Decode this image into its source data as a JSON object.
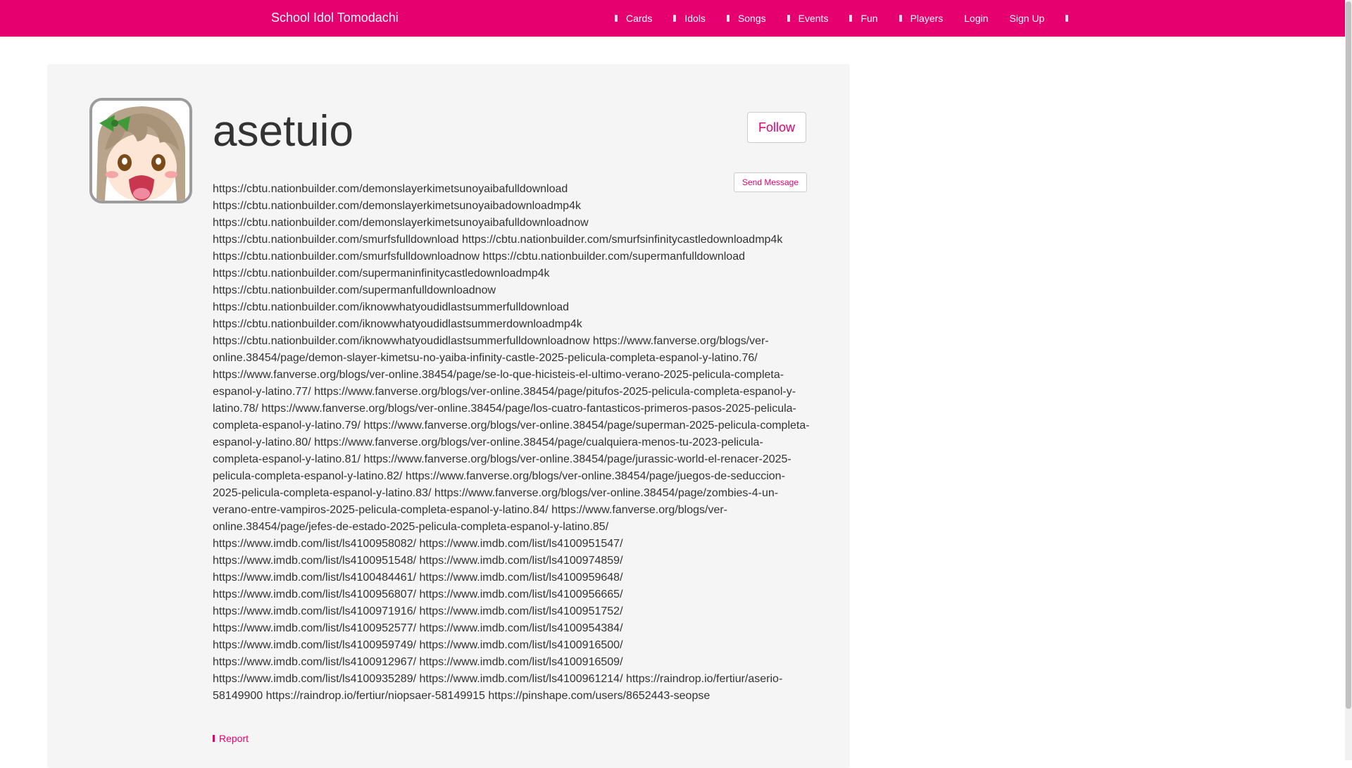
{
  "nav": {
    "brand": "School Idol Tomodachi",
    "items": [
      {
        "label": "Cards",
        "icon": "cards-icon"
      },
      {
        "label": "Idols",
        "icon": "idols-icon"
      },
      {
        "label": "Songs",
        "icon": "songs-icon"
      },
      {
        "label": "Events",
        "icon": "events-icon"
      },
      {
        "label": "Fun",
        "icon": "fun-icon"
      },
      {
        "label": "Players",
        "icon": "players-icon"
      },
      {
        "label": "Login"
      },
      {
        "label": "Sign Up"
      }
    ]
  },
  "profile": {
    "username": "asetuio",
    "follow_label": "Follow",
    "message_label": "Send Message",
    "report_label": "Report",
    "bio": "https://cbtu.nationbuilder.com/demonslayerkimetsunoyaibafulldownload https://cbtu.nationbuilder.com/demonslayerkimetsunoyaibadownloadmp4k https://cbtu.nationbuilder.com/demonslayerkimetsunoyaibafulldownloadnow https://cbtu.nationbuilder.com/smurfsfulldownload https://cbtu.nationbuilder.com/smurfsinfinitycastledownloadmp4k https://cbtu.nationbuilder.com/smurfsfulldownloadnow https://cbtu.nationbuilder.com/supermanfulldownload https://cbtu.nationbuilder.com/supermaninfinitycastledownloadmp4k https://cbtu.nationbuilder.com/supermanfulldownloadnow https://cbtu.nationbuilder.com/iknowwhatyoudidlastsummerfulldownload https://cbtu.nationbuilder.com/iknowwhatyoudidlastsummerdownloadmp4k https://cbtu.nationbuilder.com/iknowwhatyoudidlastsummerfulldownloadnow https://www.fanverse.org/blogs/ver-online.38454/page/demon-slayer-kimetsu-no-yaiba-infinity-castle-2025-pelicula-completa-espanol-y-latino.76/ https://www.fanverse.org/blogs/ver-online.38454/page/se-lo-que-hicisteis-el-ultimo-verano-2025-pelicula-completa-espanol-y-latino.77/ https://www.fanverse.org/blogs/ver-online.38454/page/pitufos-2025-pelicula-completa-espanol-y-latino.78/ https://www.fanverse.org/blogs/ver-online.38454/page/los-cuatro-fantasticos-primeros-pasos-2025-pelicula-completa-espanol-y-latino.79/ https://www.fanverse.org/blogs/ver-online.38454/page/superman-2025-pelicula-completa-espanol-y-latino.80/ https://www.fanverse.org/blogs/ver-online.38454/page/cualquiera-menos-tu-2023-pelicula-completa-espanol-y-latino.81/ https://www.fanverse.org/blogs/ver-online.38454/page/jurassic-world-el-renacer-2025-pelicula-completa-espanol-y-latino.82/ https://www.fanverse.org/blogs/ver-online.38454/page/juegos-de-seduccion-2025-pelicula-completa-espanol-y-latino.83/ https://www.fanverse.org/blogs/ver-online.38454/page/zombies-4-un-verano-entre-vampiros-2025-pelicula-completa-espanol-y-latino.84/ https://www.fanverse.org/blogs/ver-online.38454/page/jefes-de-estado-2025-pelicula-completa-espanol-y-latino.85/ https://www.imdb.com/list/ls4100958082/ https://www.imdb.com/list/ls4100951547/ https://www.imdb.com/list/ls4100951548/ https://www.imdb.com/list/ls4100974859/ https://www.imdb.com/list/ls4100484461/ https://www.imdb.com/list/ls4100959648/ https://www.imdb.com/list/ls4100956807/ https://www.imdb.com/list/ls4100956665/ https://www.imdb.com/list/ls4100971916/ https://www.imdb.com/list/ls4100951752/ https://www.imdb.com/list/ls4100952577/ https://www.imdb.com/list/ls4100954384/ https://www.imdb.com/list/ls4100959749/ https://www.imdb.com/list/ls4100916500/ https://www.imdb.com/list/ls4100912967/ https://www.imdb.com/list/ls4100916509/ https://www.imdb.com/list/ls4100935289/ https://www.imdb.com/list/ls4100961214/ https://raindrop.io/fertiur/aserio-58149900 https://raindrop.io/fertiur/niopsaer-58149915 https://pinshape.com/users/8652443-seopse"
  },
  "colors": {
    "accent": "#e6006f",
    "panel": "#f5f5f5"
  }
}
